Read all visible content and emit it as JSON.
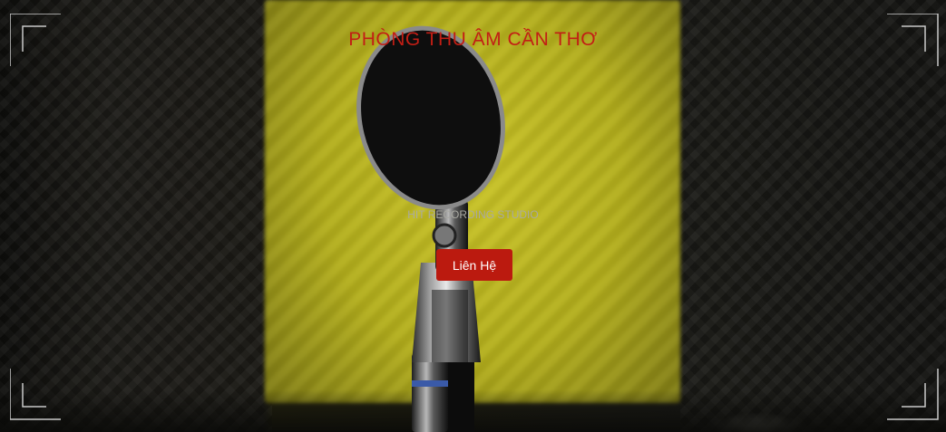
{
  "hero": {
    "title": "PHÒNG THU ÂM CẦN THƠ",
    "subtitle": "HIT RECORDING STUDIO",
    "contact_button_label": "Liên Hệ"
  },
  "colors": {
    "accent": "#c21e15",
    "button_bg": "#bb1a0f",
    "subtitle": "#a9a9a2",
    "panel_yellow": "#c8c226"
  },
  "icons": {
    "corners": "frame-corner-icon",
    "background": "microphone-image"
  }
}
